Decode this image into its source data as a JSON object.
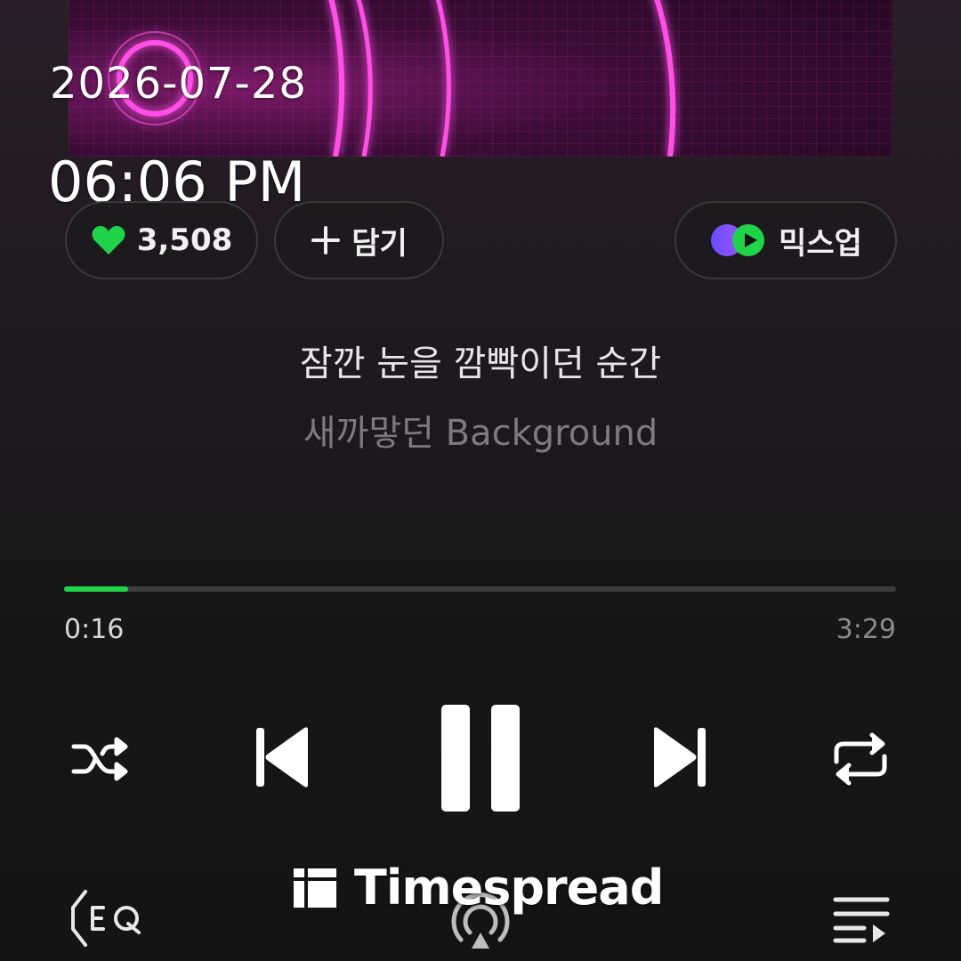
{
  "overlay": {
    "date": "2026-07-28",
    "time": "06:06 PM"
  },
  "actions": {
    "like_count": "3,508",
    "add_label": "담기",
    "mixup_label": "믹스업"
  },
  "lyrics": {
    "current": "잠깐 눈을 깜빡이던 순간",
    "next": "새까맣던 Background"
  },
  "progress": {
    "elapsed": "0:16",
    "total": "3:29",
    "fraction": 0.0766
  },
  "watermark": {
    "text": "Timespread"
  },
  "colors": {
    "accent": "#1fd34a",
    "neon": "#ff3cdc"
  },
  "icons": {
    "like": "heart-icon",
    "add": "plus-icon",
    "mixup": "mixup-icon",
    "shuffle": "shuffle-icon",
    "prev": "skip-previous-icon",
    "pause": "pause-icon",
    "next": "skip-next-icon",
    "repeat": "repeat-icon",
    "eq": "eq-icon",
    "cast": "cast-icon",
    "playlist": "playlist-icon"
  }
}
